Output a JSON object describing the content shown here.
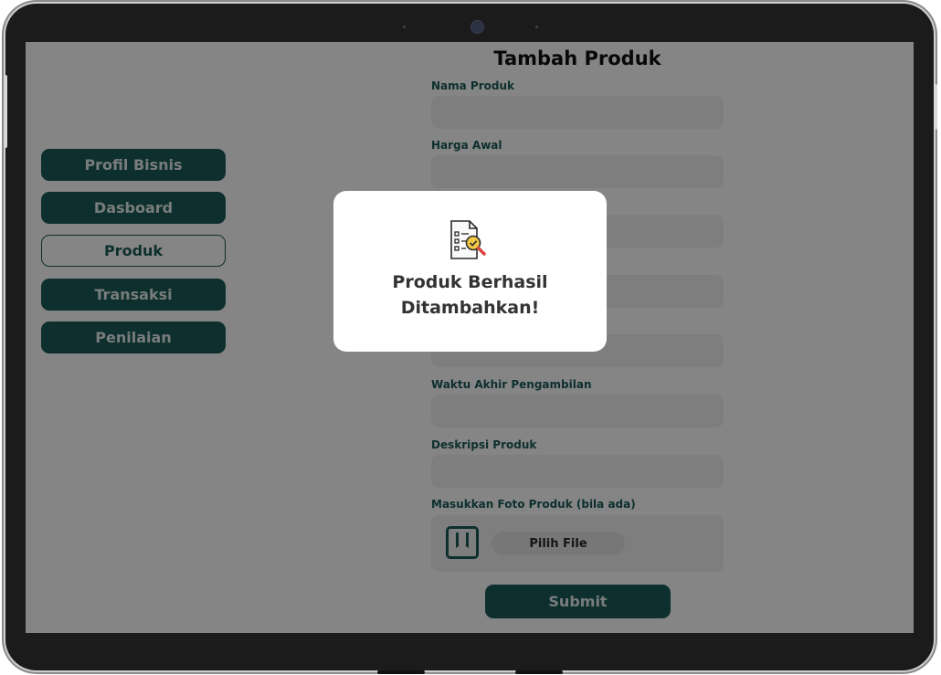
{
  "sidebar": {
    "items": [
      {
        "label": "Profil Bisnis"
      },
      {
        "label": "Dasboard"
      },
      {
        "label": "Produk"
      },
      {
        "label": "Transaksi"
      },
      {
        "label": "Penilaian"
      }
    ]
  },
  "form": {
    "title": "Tambah Produk",
    "fields": [
      {
        "label": "Nama Produk",
        "value": ""
      },
      {
        "label": "Harga Awal",
        "value": ""
      },
      {
        "label": "",
        "value": ""
      },
      {
        "label": "",
        "value": ""
      },
      {
        "label": "",
        "value": ""
      },
      {
        "label": "Waktu Akhir Pengambilan",
        "value": ""
      },
      {
        "label": "Deskripsi Produk",
        "value": ""
      }
    ],
    "upload_label": "Masukkan Foto Produk (bila ada)",
    "upload_button": "Pilih File",
    "submit_label": "Submit"
  },
  "modal": {
    "icon": "document-check-icon",
    "line1": "Produk Berhasil",
    "line2": "Ditambahkan!"
  },
  "colors": {
    "primary": "#1a5a57",
    "overlay": "rgba(0,0,0,0.48)"
  }
}
